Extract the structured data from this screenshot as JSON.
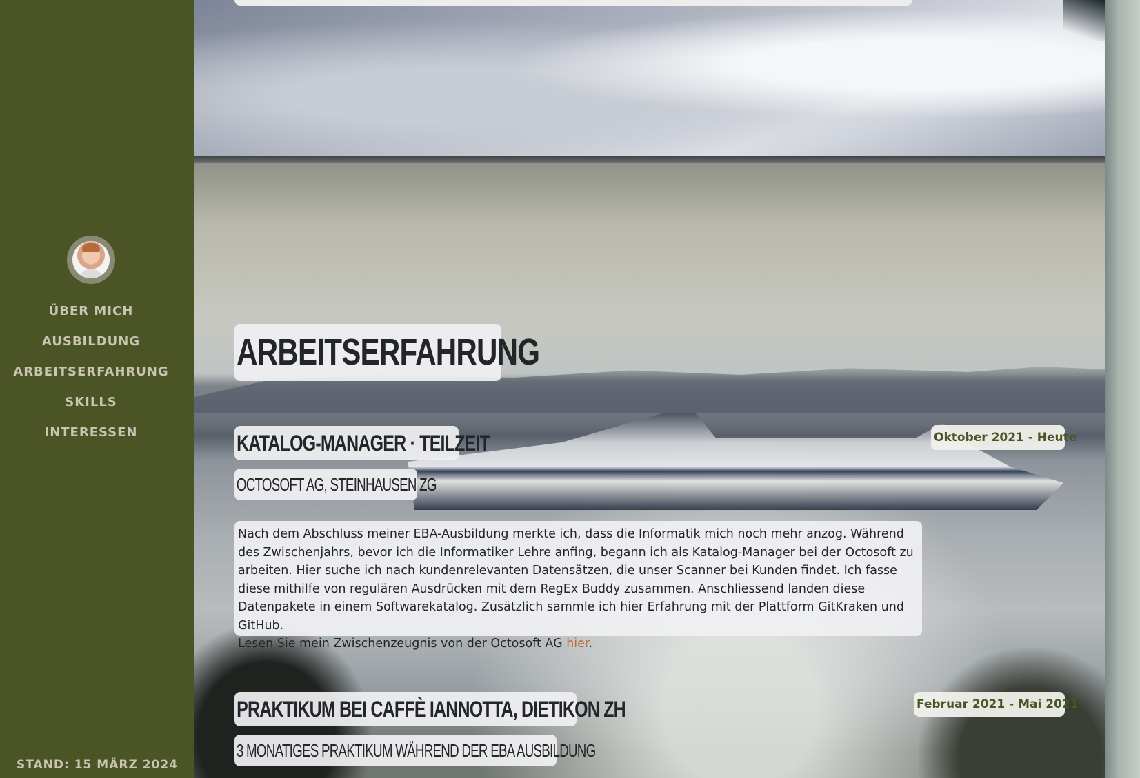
{
  "sidebar": {
    "nav": [
      {
        "label": "Über mich"
      },
      {
        "label": "Ausbildung"
      },
      {
        "label": "Arbeitserfahrung"
      },
      {
        "label": "Skills"
      },
      {
        "label": "Interessen"
      }
    ],
    "stand": "Stand: 15 März 2024"
  },
  "main": {
    "section_title": "Arbeitserfahrung",
    "jobs": [
      {
        "title": "Katalog-Manager · Teilzeit",
        "subtitle": "Octosoft AG, Steinhausen ZG",
        "date": "Oktober 2021 - Heute",
        "description": "Nach dem Abschluss meiner EBA-Ausbildung merkte ich, dass die Informatik mich noch mehr anzog. Während des Zwischenjahrs, bevor ich die Informatiker Lehre anfing, begann ich als Katalog-Manager bei der Octosoft zu arbeiten. Hier suche ich nach kundenrelevanten Datensätzen, die unser Scanner bei Kunden findet. Ich fasse diese mithilfe von regulären Ausdrücken mit dem RegEx Buddy zusammen. Anschliessend landen diese Datenpakete in einem Softwarekatalog. Zusätzlich sammle ich hier Erfahrung mit der Plattform GitKraken und GitHub.",
        "reference_text": "Lesen Sie mein Zwischenzeugnis von der Octosoft AG ",
        "reference_link": "hier",
        "reference_end": "."
      },
      {
        "title": "Praktikum bei Caffè Iannotta, Dietikon ZH",
        "subtitle": "3 monatiges Praktikum während der EBA Ausbildung",
        "date": "Februar 2021 - Mai 2021"
      }
    ]
  },
  "colors": {
    "sidebar_bg": "#4a5424",
    "nav_text": "#c9c5b3",
    "date_text": "#4a5424",
    "link": "#c06a3c"
  }
}
